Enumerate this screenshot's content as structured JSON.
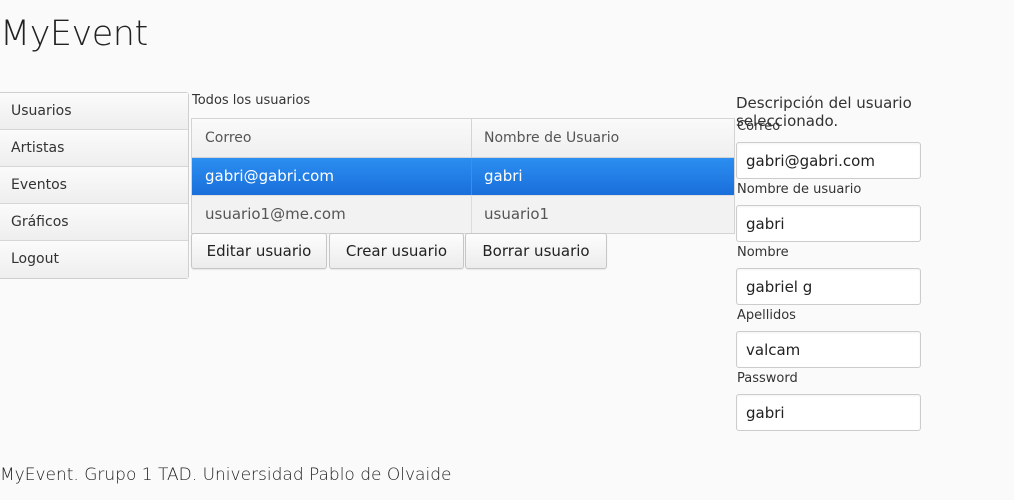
{
  "app": {
    "title": "MyEvent"
  },
  "sidebar": {
    "items": [
      {
        "label": "Usuarios"
      },
      {
        "label": "Artistas"
      },
      {
        "label": "Eventos"
      },
      {
        "label": "Gráficos"
      },
      {
        "label": "Logout"
      }
    ]
  },
  "users": {
    "caption": "Todos los usuarios",
    "columns": [
      "Correo",
      "Nombre de Usuario"
    ],
    "rows": [
      {
        "email": "gabri@gabri.com",
        "username": "gabri",
        "selected": true
      },
      {
        "email": "usuario1@me.com",
        "username": "usuario1",
        "selected": false
      }
    ],
    "buttons": {
      "edit": "Editar usuario",
      "create": "Crear usuario",
      "delete": "Borrar usuario"
    }
  },
  "detail": {
    "title": "Descripción del usuario seleccionado.",
    "fields": [
      {
        "label": "Correo",
        "value": "gabri@gabri.com"
      },
      {
        "label": "Nombre de usuario",
        "value": "gabri"
      },
      {
        "label": "Nombre",
        "value": "gabriel g"
      },
      {
        "label": "Apellidos",
        "value": "valcam"
      },
      {
        "label": "Password",
        "value": "gabri"
      }
    ]
  },
  "footer": {
    "text": "MyEvent. Grupo 1 TAD. Universidad Pablo de Olvaide"
  },
  "colors": {
    "selection": "#1a6fdb",
    "background": "#fafafa"
  }
}
